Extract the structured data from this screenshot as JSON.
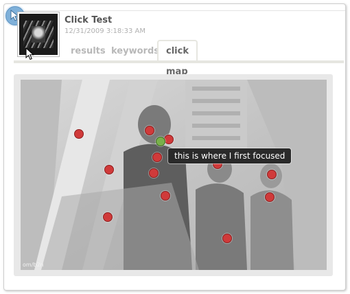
{
  "item": {
    "title": "Click Test",
    "timestamp": "12/31/2009 3:18:33 AM"
  },
  "tabs": [
    {
      "label": "results",
      "active": false
    },
    {
      "label": "keywords",
      "active": false
    },
    {
      "label": "click map",
      "active": true
    }
  ],
  "clickmap": {
    "tooltip": "this is where I first focused",
    "watermark": "om/b2n",
    "dot_count_red": 13,
    "dot_count_green": 1
  },
  "colors": {
    "accent_cursor_badge": "#7fb0d9",
    "click_dot": "#d03a3a",
    "first_focus_dot": "#79b04b",
    "tooltip_bg": "#2a2a2a"
  },
  "icons": [
    "pointer-cursor-icon",
    "mouse-cursor-icon"
  ]
}
